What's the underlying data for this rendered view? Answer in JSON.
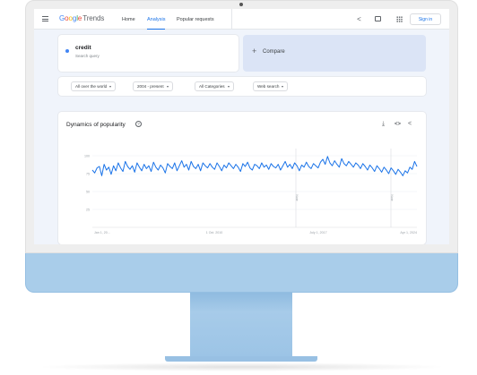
{
  "app": {
    "logo_google": "Google",
    "logo_trends": "Trends",
    "nav": {
      "home": "Home",
      "analysis": "Analysis",
      "popular": "Popular requests"
    },
    "sign_in": "Sign in"
  },
  "search": {
    "term": "credit",
    "term_sub": "Search query",
    "term_color": "#4285f4",
    "compare_label": "Compare"
  },
  "filters": {
    "region": "All over the world",
    "period": "2004 - present",
    "category": "All Categories",
    "search_type": "Web search"
  },
  "chart_card": {
    "title": "Dynamics of popularity"
  },
  "chart_data": {
    "type": "line",
    "series": [
      {
        "color": "#1a73e8",
        "values": [
          80,
          76,
          83,
          85,
          72,
          88,
          80,
          84,
          74,
          86,
          79,
          90,
          83,
          78,
          92,
          85,
          81,
          86,
          77,
          90,
          84,
          79,
          88,
          82,
          86,
          78,
          91,
          84,
          80,
          87,
          83,
          76,
          89,
          85,
          82,
          90,
          79,
          86,
          93,
          84,
          88,
          80,
          92,
          85,
          82,
          88,
          79,
          90,
          86,
          83,
          89,
          84,
          81,
          90,
          85,
          79,
          87,
          83,
          90,
          86,
          82,
          88,
          84,
          78,
          89,
          85,
          91,
          83,
          80,
          88,
          86,
          82,
          90,
          84,
          87,
          81,
          89,
          85,
          83,
          88,
          80,
          86,
          92,
          84,
          88,
          82,
          90,
          86,
          79,
          87,
          84,
          91,
          85,
          82,
          89,
          86,
          83,
          91,
          95,
          88,
          99,
          90,
          86,
          93,
          88,
          84,
          96,
          89,
          86,
          92,
          88,
          84,
          90,
          87,
          82,
          89,
          85,
          80,
          87,
          83,
          78,
          86,
          82,
          77,
          84,
          80,
          75,
          83,
          79,
          74,
          81,
          77,
          72,
          79,
          76,
          84,
          81,
          92,
          85
        ]
      }
    ],
    "ylim": [
      0,
      100
    ],
    "y_ticks": [
      "100",
      "75",
      "50",
      "25"
    ],
    "x_ticks": [
      "Jan 1, 20...",
      "1 Oct. 2010",
      "July 1, 2017",
      "Apr 1, 2024"
    ],
    "annotations": [
      "Note",
      "Note"
    ],
    "grid": true
  }
}
